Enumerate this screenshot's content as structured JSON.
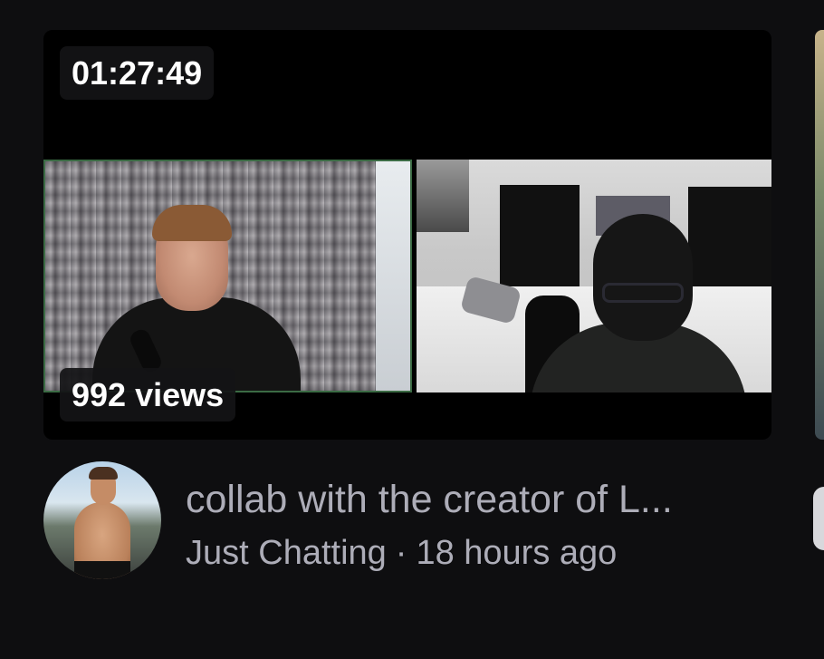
{
  "video": {
    "duration": "01:27:49",
    "views": "992 views",
    "title": "collab with the creator of L...",
    "category": "Just Chatting",
    "separator": "·",
    "age": "18 hours ago"
  },
  "colors": {
    "background": "#0e0e10",
    "meta_text": "#adadb8",
    "badge_bg": "#141416",
    "webcam_border": "#3b6b44"
  }
}
